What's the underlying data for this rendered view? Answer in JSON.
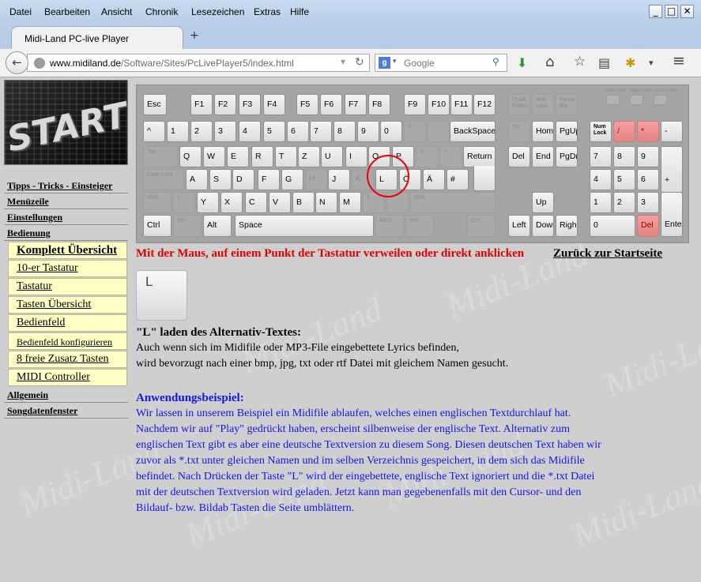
{
  "menu": [
    "Datei",
    "Bearbeiten",
    "Ansicht",
    "Chronik",
    "Lesezeichen",
    "Extras",
    "Hilfe"
  ],
  "window": {
    "minimize": "_",
    "maximize": "□",
    "close": "✕"
  },
  "tab": {
    "title": "Midi-Land PC-live Player",
    "newtab": "+"
  },
  "url": {
    "domain": "www.midiland.de",
    "path": "/Software/Sites/PcLivePlayer5/index.html"
  },
  "search": {
    "engine": "g",
    "placeholder": "Google"
  },
  "icons": {
    "back": "←",
    "download": "⬇",
    "home": "⌂",
    "star": "☆",
    "reader": "▤",
    "addon": "✱",
    "menu": "≡",
    "dropdown": "▾",
    "reload": "↻"
  },
  "logo": "START",
  "sidebar": {
    "sec1": "Tipps - Tricks - Einsteiger",
    "sec2": "Menüzeile",
    "sec3": "Einstellungen",
    "sec4": "Bedienung",
    "items": [
      "Komplett Übersicht",
      "10-er Tastatur",
      "Tastatur",
      "Tasten Übersicht",
      "Bedienfeld",
      "Bedienfeld konfigurieren",
      "8 freie Zusatz Tasten",
      "MIDI Controller"
    ],
    "sec5": "Allgemein",
    "sec6": "Songdatenfenster"
  },
  "keyboard": {
    "row0": [
      "Esc",
      "F1",
      "F2",
      "F3",
      "F4",
      "F5",
      "F6",
      "F7",
      "F8",
      "F9",
      "F10",
      "F11",
      "F12"
    ],
    "row0d": [
      "Druck Rollen",
      "Roll Lock",
      "Pause Brk"
    ],
    "leds": [
      "Num Lock",
      "Caps Lock",
      "Scroll Lock"
    ],
    "row1": [
      "^",
      "1",
      "2",
      "3",
      "4",
      "5",
      "6",
      "7",
      "8",
      "9",
      "0",
      "BackSpace"
    ],
    "row1d": [
      "ß",
      "´",
      "Ins"
    ],
    "nav1": [
      "Home",
      "PgUp"
    ],
    "num1": [
      "Num Lock",
      "/",
      "*",
      "-"
    ],
    "row2d": [
      "Tab",
      "Ü",
      "+"
    ],
    "row2": [
      "Q",
      "W",
      "E",
      "R",
      "T",
      "Z",
      "U",
      "I",
      "O",
      "P",
      "Return"
    ],
    "nav2": [
      "Del",
      "End",
      "PgDn"
    ],
    "num2": [
      "7",
      "8",
      "9",
      "+"
    ],
    "row3d": [
      "Caps Lock",
      "K"
    ],
    "row3": [
      "A",
      "S",
      "D",
      "F",
      "G",
      "H",
      "J",
      "L",
      "Ö",
      "Ä",
      "#"
    ],
    "num3": [
      "4",
      "5",
      "6"
    ],
    "row4d": [
      "Shift",
      "<",
      "§",
      "-",
      "Shift"
    ],
    "row4": [
      "Y",
      "X",
      "C",
      "V",
      "B",
      "N",
      "M"
    ],
    "up": "Up",
    "num4": [
      "1",
      "2",
      "3",
      "Enter"
    ],
    "row5": [
      "Ctrl",
      "Alt",
      "Space",
      "Left",
      "Down",
      "Right"
    ],
    "row5d": [
      "Win",
      "AltGr",
      "Win",
      "Ctrl"
    ],
    "num5": [
      "0",
      "Del"
    ]
  },
  "instruction": "Mit der Maus, auf einem Punkt der Tastatur verweilen oder direkt anklicken",
  "backlink": "Zurück zur Startseite",
  "bigkey": "L",
  "content": {
    "title": "\"L\" laden des Alternativ-Textes:",
    "line1": "Auch wenn sich im Midifile oder MP3-File eingebettete Lyrics befinden,",
    "line2": "wird bevorzugt nach einer bmp, jpg, txt oder rtf Datei mit gleichem Namen gesucht.",
    "example_title": "Anwendungsbeispiel:",
    "example": "Wir lassen in unserem Beispiel ein Midifile ablaufen, welches einen englischen Textdurchlauf hat. Nachdem wir auf \"Play\" gedrückt haben, erscheint silbenweise der englische Text. Alternativ zum englischen Text gibt es aber eine deutsche Textversion zu diesem Song. Diesen deutschen Text haben wir zuvor als *.txt unter gleichen Namen und im selben Verzeichnis gespeichert, in dem sich das Midifile befindet. Nach Drücken der Taste \"L\" wird der eingebettete, englische Text ignoriert und die *.txt Datei mit der deutschen Textversion wird geladen. Jetzt kann man gegebenenfalls mit den Cursor- und den Bildauf- bzw. Bildab Tasten die Seite umblättern."
  },
  "watermark": "Midi-Land"
}
